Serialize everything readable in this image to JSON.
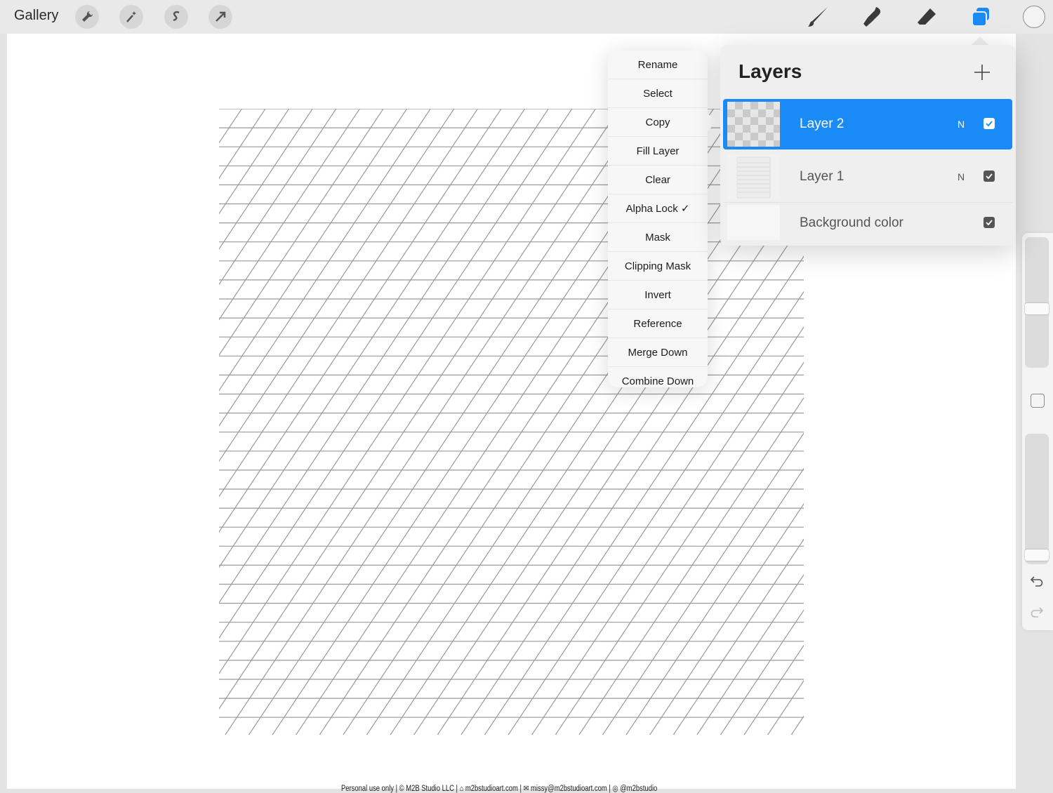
{
  "toolbar": {
    "gallery_label": "Gallery",
    "left_icons": [
      "wrench-icon",
      "magic-wand-icon",
      "selection-s-icon",
      "transform-arrow-icon"
    ],
    "right_icons": [
      "brush-icon",
      "smudge-icon",
      "eraser-icon",
      "layers-icon"
    ],
    "accent_color": "#1a8af7"
  },
  "context_menu": {
    "items": [
      {
        "label": "Rename"
      },
      {
        "label": "Select"
      },
      {
        "label": "Copy"
      },
      {
        "label": "Fill Layer"
      },
      {
        "label": "Clear"
      },
      {
        "label": "Alpha Lock ✓"
      },
      {
        "label": "Mask"
      },
      {
        "label": "Clipping Mask"
      },
      {
        "label": "Invert"
      },
      {
        "label": "Reference"
      },
      {
        "label": "Merge Down"
      },
      {
        "label": "Combine Down"
      }
    ]
  },
  "layers_panel": {
    "title": "Layers",
    "layers": [
      {
        "name": "Layer 2",
        "blend": "N",
        "visible": true,
        "selected": true
      },
      {
        "name": "Layer 1",
        "blend": "N",
        "visible": true,
        "selected": false
      },
      {
        "name": "Background color",
        "blend": "",
        "visible": true,
        "selected": false
      }
    ]
  },
  "canvas": {
    "footer_text": "Personal use only | © M2B Studio LLC | ⌂ m2bstudioart.com | ✉ missy@m2bstudioart.com | ◎ @m2bstudio"
  },
  "sidebar": {
    "brush_size_level": 0.55,
    "opacity_level": 0.97
  }
}
